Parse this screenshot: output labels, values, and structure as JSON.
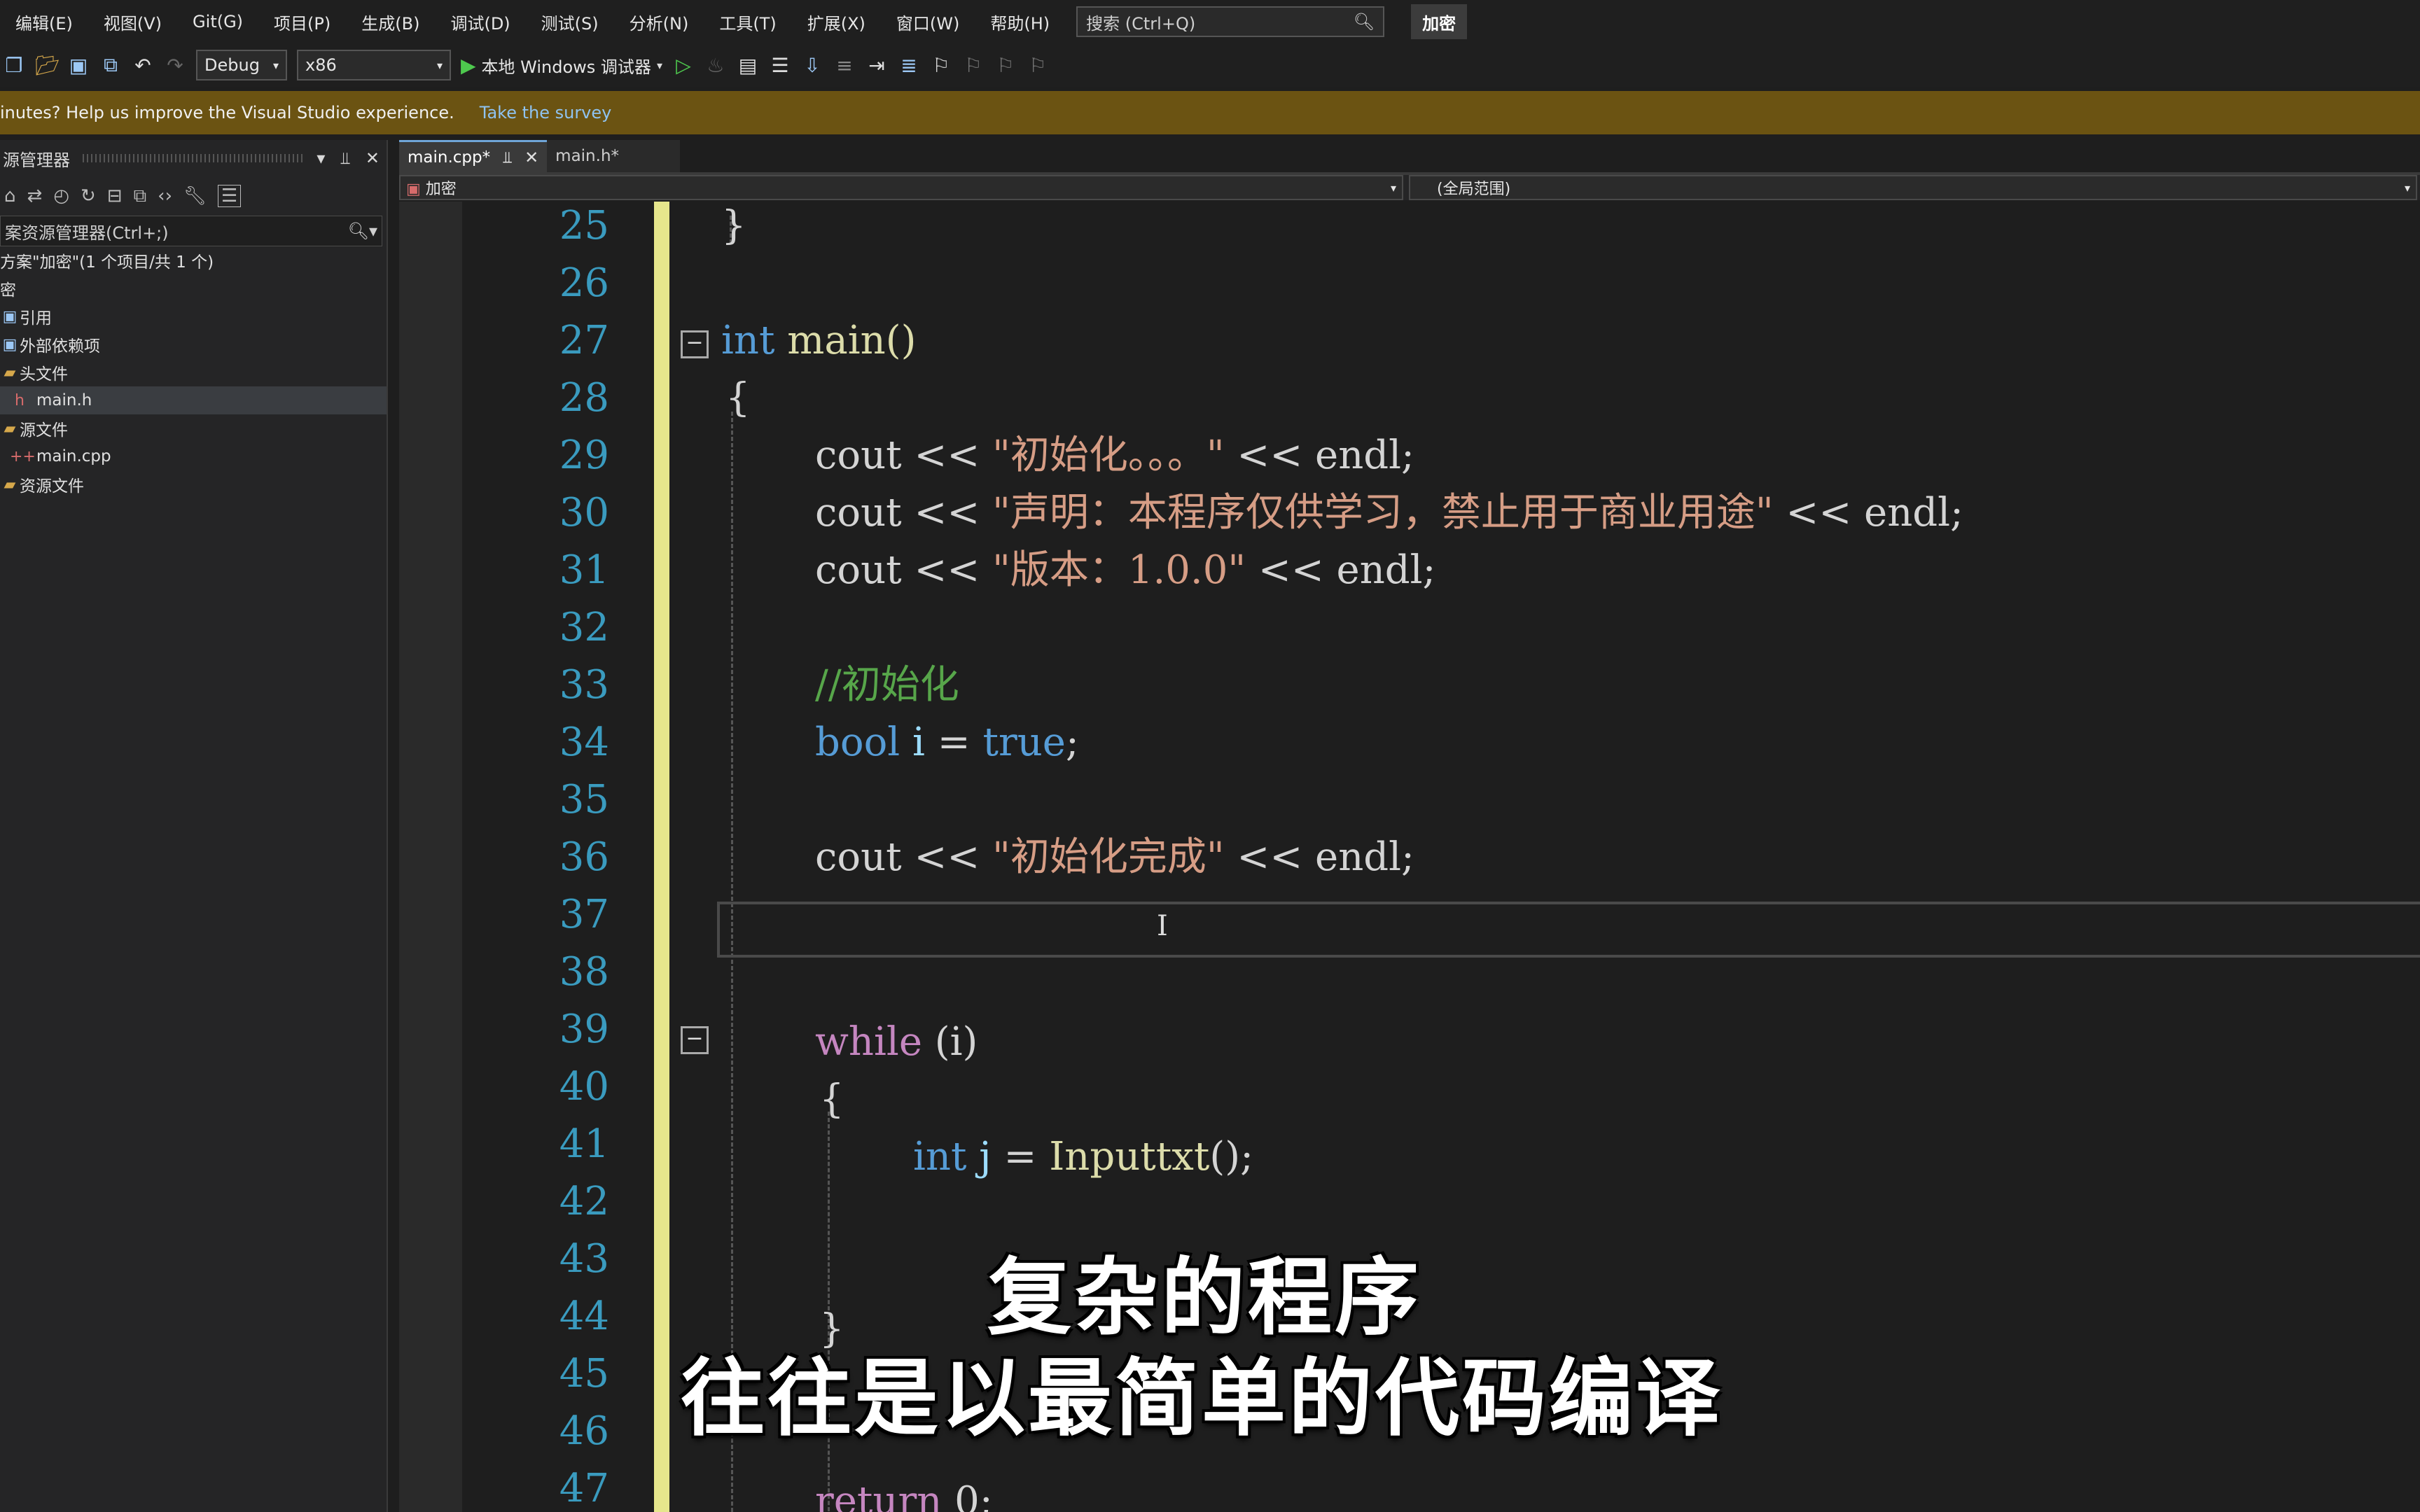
{
  "menu": {
    "items": [
      "编辑(E)",
      "视图(V)",
      "Git(G)",
      "项目(P)",
      "生成(B)",
      "调试(D)",
      "测试(S)",
      "分析(N)",
      "工具(T)",
      "扩展(X)",
      "窗口(W)",
      "帮助(H)"
    ],
    "search_placeholder": "搜索 (Ctrl+Q)",
    "title_badge": "加密"
  },
  "toolbar": {
    "config": "Debug",
    "platform": "x86",
    "run_label": "本地 Windows 调试器"
  },
  "survey": {
    "message": "inutes? Help us improve the Visual Studio experience.",
    "link": "Take the survey"
  },
  "solution_explorer": {
    "title": "源管理器",
    "search_placeholder": "案资源管理器(Ctrl+;)",
    "items": [
      {
        "label": "方案\"加密\"(1 个项目/共 1 个)"
      },
      {
        "label": "密"
      },
      {
        "label": "引用"
      },
      {
        "label": "外部依赖项"
      },
      {
        "label": "头文件"
      },
      {
        "label": "main.h"
      },
      {
        "label": "源文件"
      },
      {
        "label": "main.cpp"
      },
      {
        "label": "资源文件"
      }
    ]
  },
  "tabs": {
    "active": "main.cpp*",
    "inactive": "main.h*"
  },
  "navbar": {
    "project": "加密",
    "scope": "(全局范围)"
  },
  "editor": {
    "line_numbers": [
      "25",
      "26",
      "27",
      "28",
      "29",
      "30",
      "31",
      "32",
      "33",
      "34",
      "35",
      "36",
      "37",
      "38",
      "39",
      "40",
      "41",
      "42",
      "43",
      "44",
      "45",
      "46",
      "47"
    ],
    "tokens": {
      "l25_brace": "}",
      "l27_int": "int",
      "l27_main": " main()",
      "l28_brace": "{",
      "l29_cout": "cout << ",
      "l29_str": "\"初始化。。。\"",
      "l29_end": " << endl;",
      "l30_cout": "cout << ",
      "l30_str": "\"声明：本程序仅供学习，禁止用于商业用途\"",
      "l30_end": " << endl;",
      "l31_cout": "cout << ",
      "l31_str": "\"版本：1.0.0\"",
      "l31_end": " << endl;",
      "l33_cmt": "//初始化",
      "l34_bool": "bool",
      "l34_i": " i ",
      "l34_eq": "= ",
      "l34_true": "true",
      "l34_semi": ";",
      "l36_cout": "cout << ",
      "l36_str": "\"初始化完成\"",
      "l36_end": " << endl;",
      "l39_while": "while",
      "l39_cond": " (i)",
      "l40_brace": "{",
      "l41_int": "int",
      "l41_j": " j ",
      "l41_eq": "= ",
      "l41_fn": "Inputtxt",
      "l41_end": "();",
      "l44_brace": "}",
      "l47_return": "return",
      "l47_end": " 0;"
    }
  },
  "subtitles": {
    "line1": "复杂的程序",
    "line2": "往往是以最简单的代码编译"
  }
}
